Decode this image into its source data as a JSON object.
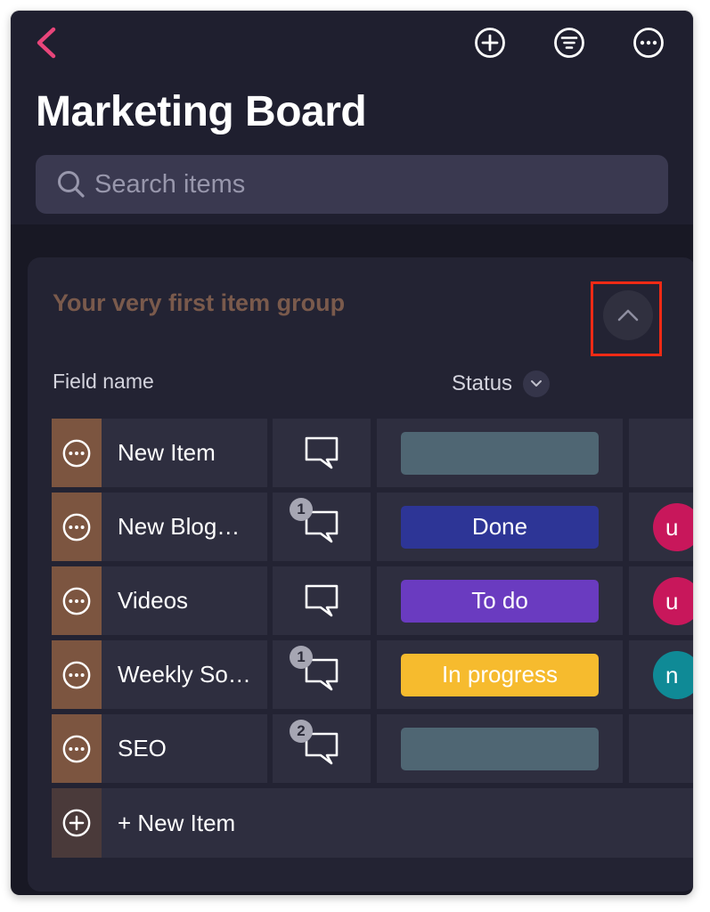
{
  "header": {
    "back_icon": "chevron-left-icon",
    "actions": [
      {
        "name": "add-button",
        "icon": "plus-circle-icon"
      },
      {
        "name": "filter-button",
        "icon": "filter-icon"
      },
      {
        "name": "more-button",
        "icon": "ellipsis-circle-icon"
      }
    ],
    "title": "Marketing Board"
  },
  "search": {
    "placeholder": "Search items",
    "value": ""
  },
  "group": {
    "title": "Your very first item group",
    "collapse_icon": "chevron-up-icon",
    "columns": {
      "field_name": "Field name",
      "status": "Status"
    },
    "rows": [
      {
        "name": "New Item",
        "comments": "",
        "status": "",
        "status_color": "#4f6673",
        "avatar": "",
        "avatar_color": ""
      },
      {
        "name": "New Blog…",
        "comments": "1",
        "status": "Done",
        "status_color": "#2d3596",
        "avatar": "u",
        "avatar_color": "#c8175b"
      },
      {
        "name": "Videos",
        "comments": "",
        "status": "To do",
        "status_color": "#6a3bc0",
        "avatar": "u",
        "avatar_color": "#c8175b"
      },
      {
        "name": "Weekly So…",
        "comments": "1",
        "status": "In progress",
        "status_color": "#f6bb2e",
        "avatar": "n",
        "avatar_color": "#0f8a96"
      },
      {
        "name": "SEO",
        "comments": "2",
        "status": "",
        "status_color": "#4f6673",
        "avatar": "",
        "avatar_color": ""
      }
    ],
    "new_item_label": "+ New Item"
  },
  "colors": {
    "background": "#181824",
    "card": "#232333",
    "cell": "#2e2e3f",
    "item_handle": "#7c5540",
    "accent_back": "#e8457a",
    "highlight": "#ef2a15"
  }
}
